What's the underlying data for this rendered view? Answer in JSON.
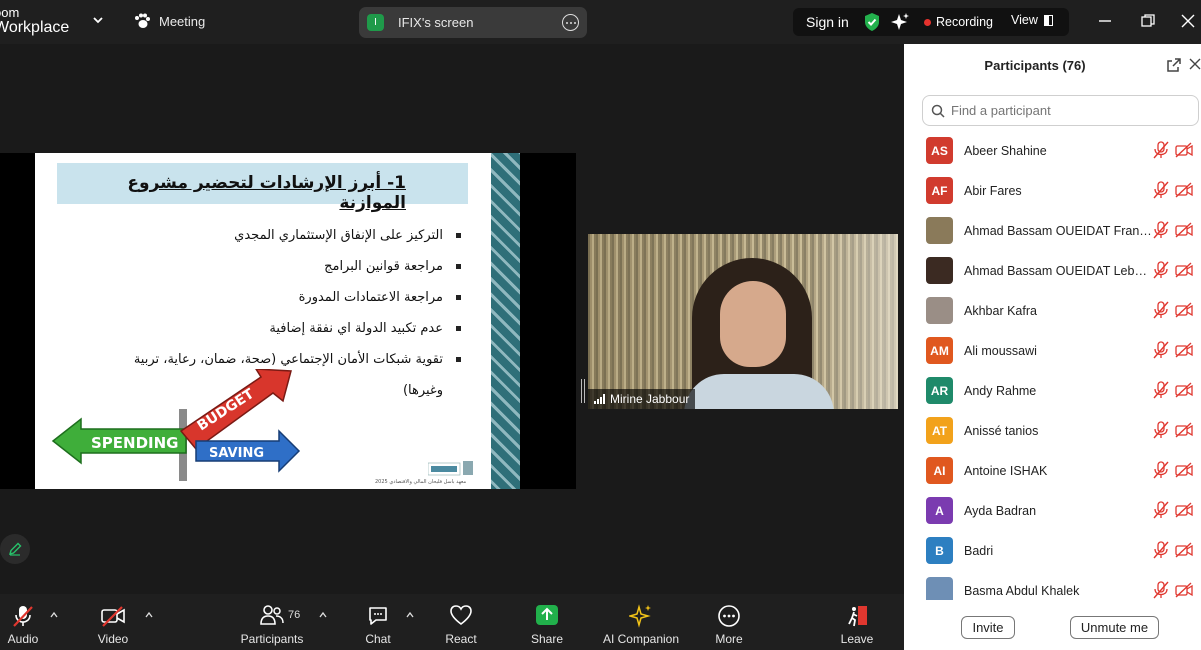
{
  "window": {
    "brand_line1": "oom",
    "brand_line2": "Workplace",
    "meeting_label": "Meeting",
    "screen_share_initial": "I",
    "screen_share_label": "IFIX's screen",
    "signin_label": "Sign in",
    "recording_label": "Recording",
    "view_label": "View"
  },
  "slide": {
    "title": "1- أبرز الإرشادات لتحضير مشروع الموازنة",
    "bullets": [
      "التركيز على الإنفاق الإستثماري المجدي",
      "مراجعة قوانين البرامج",
      "مراجعة الاعتمادات المدورة",
      "عدم تكبيد الدولة اي نفقة إضافية",
      "تقوية شبكات الأمان الإجتماعي (صحة، ضمان، رعاية، تربية",
      "وغيرها)"
    ],
    "sign_spending": "SPENDING",
    "sign_budget": "BUDGET",
    "sign_saving": "SAVING",
    "footer": "معهد باسل فليحان المالي والاقتصادي 2025"
  },
  "speaker": {
    "name": "Mirine Jabbour"
  },
  "toolbar": {
    "audio": "Audio",
    "video": "Video",
    "participants": "Participants",
    "participants_count": "76",
    "chat": "Chat",
    "react": "React",
    "share": "Share",
    "ai_companion": "AI Companion",
    "more": "More",
    "leave": "Leave"
  },
  "panel": {
    "title": "Participants (76)",
    "search_placeholder": "Find a participant",
    "participants": [
      {
        "initials": "AS",
        "name": "Abeer Shahine",
        "color": "#d13b2e"
      },
      {
        "initials": "AF",
        "name": "Abir Fares",
        "color": "#d13b2e"
      },
      {
        "initials": "",
        "name": "Ahmad Bassam OUEIDAT France",
        "color": "#8a7a5a"
      },
      {
        "initials": "",
        "name": "Ahmad Bassam OUEIDAT Lebanon",
        "color": "#3b2a22"
      },
      {
        "initials": "",
        "name": "Akhbar Kafra",
        "color": "#9a8e86"
      },
      {
        "initials": "AM",
        "name": "Ali moussawi",
        "color": "#e0581f"
      },
      {
        "initials": "AR",
        "name": "Andy Rahme",
        "color": "#1f8a6a"
      },
      {
        "initials": "AT",
        "name": "Anissé tanios",
        "color": "#f2a21b"
      },
      {
        "initials": "AI",
        "name": "Antoine ISHAK",
        "color": "#e0581f"
      },
      {
        "initials": "A",
        "name": "Ayda Badran",
        "color": "#7b3bb0"
      },
      {
        "initials": "B",
        "name": "Badri",
        "color": "#2d7fc1"
      },
      {
        "initials": "",
        "name": "Basma Abdul Khalek",
        "color": "#6e8fb5"
      }
    ],
    "invite_label": "Invite",
    "unmute_label": "Unmute me"
  },
  "colors": {
    "accent_green": "#1f9a4a",
    "recording_red": "#e5322d",
    "muted_red": "#e0372f",
    "share_green": "#21b04b"
  }
}
